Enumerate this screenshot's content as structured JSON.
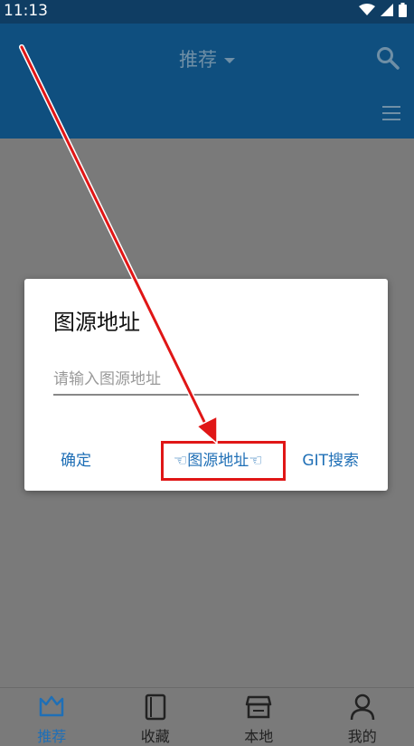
{
  "status_bar": {
    "time": "11:13"
  },
  "app_bar": {
    "title": "推荐"
  },
  "dialog": {
    "title": "图源地址",
    "input_placeholder": "请输入图源地址",
    "buttons": {
      "confirm": "确定",
      "source": "☜图源地址☜",
      "git": "GIT搜索"
    }
  },
  "bottom_nav": [
    {
      "label": "推荐",
      "icon": "crown-icon",
      "active": true
    },
    {
      "label": "收藏",
      "icon": "book-icon",
      "active": false
    },
    {
      "label": "本地",
      "icon": "store-icon",
      "active": false
    },
    {
      "label": "我的",
      "icon": "person-icon",
      "active": false
    }
  ],
  "colors": {
    "app_bar": "#0f4f7f",
    "accent": "#1f6fb6",
    "annotation": "#e01616"
  }
}
